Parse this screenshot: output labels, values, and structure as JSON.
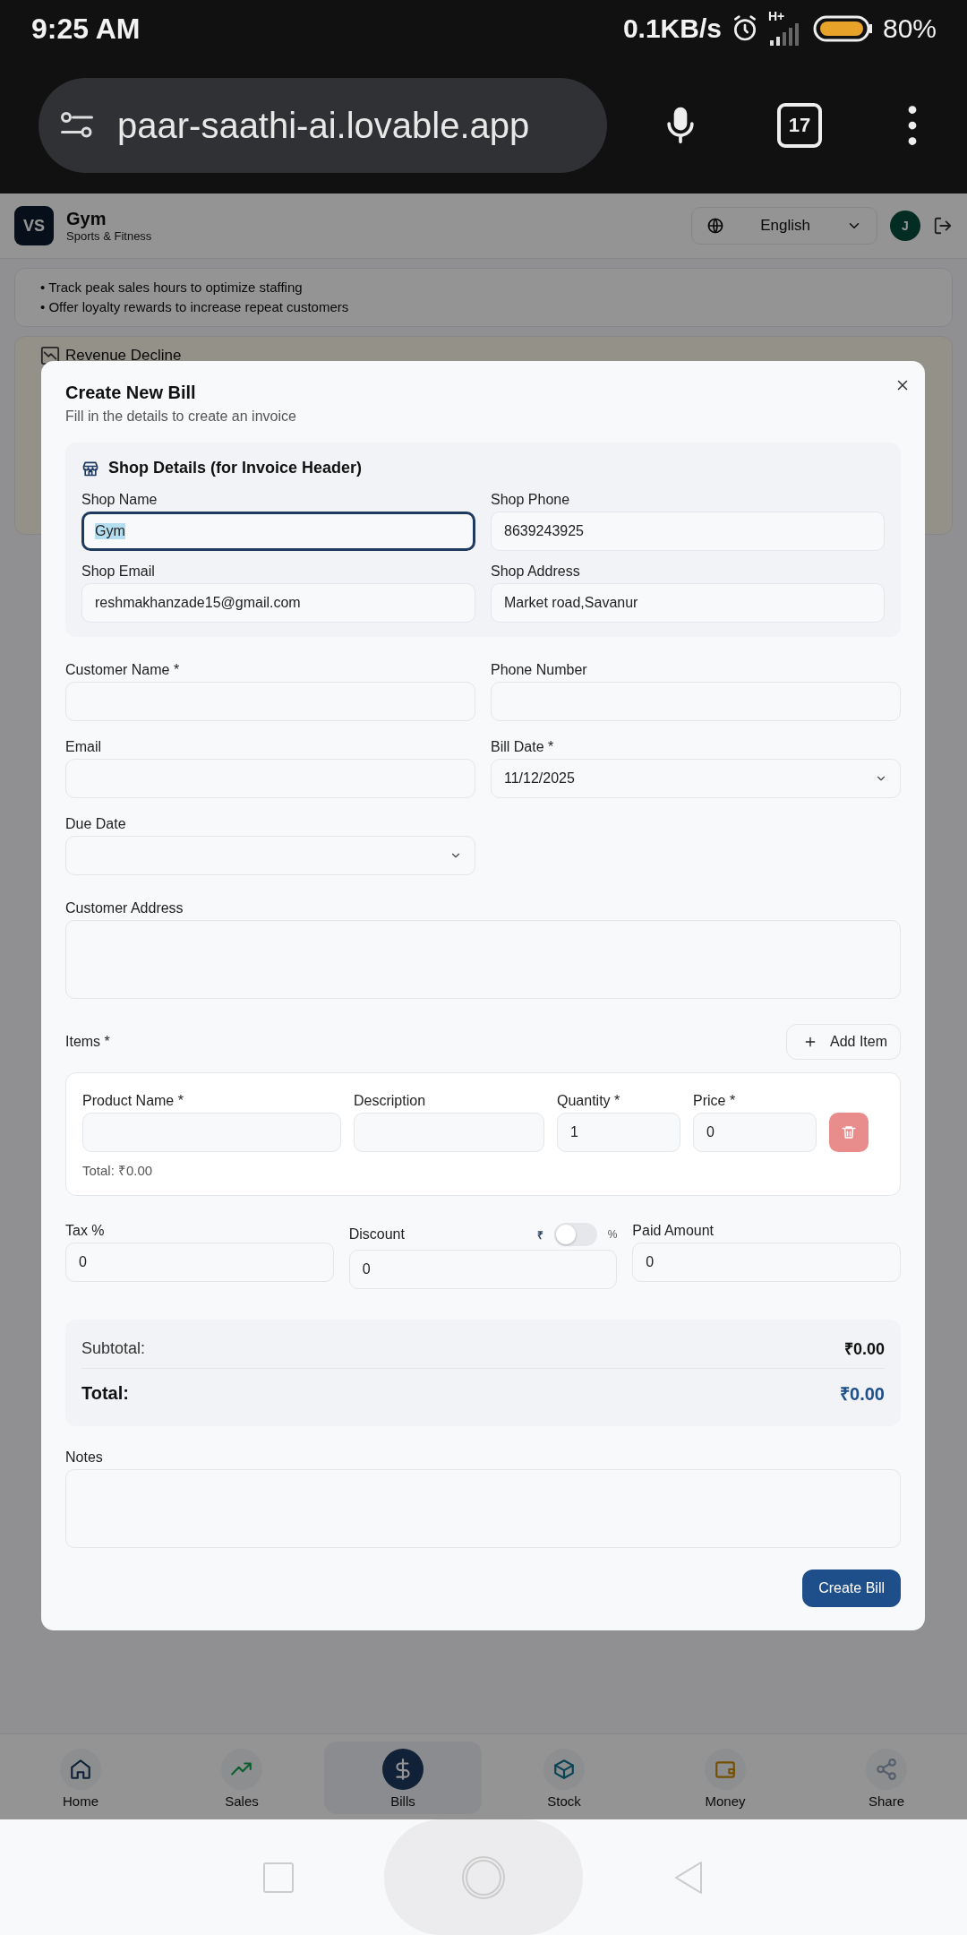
{
  "status_bar": {
    "time": "9:25 AM",
    "net_speed": "0.1KB/s",
    "network": "H+",
    "battery": "80%"
  },
  "browser": {
    "url": "paar-saathi-ai.lovable.app",
    "tab_count": "17"
  },
  "app_header": {
    "logo": "VS",
    "title": "Gym",
    "subtitle": "Sports & Fitness",
    "language": "English",
    "avatar": "J"
  },
  "background_content": {
    "tips": [
      "• Track peak sales hours to optimize staffing",
      "• Offer loyalty rewards to increase repeat customers"
    ],
    "alert_title": "Revenue Decline"
  },
  "bottom_nav": [
    {
      "label": "Home",
      "selected": false
    },
    {
      "label": "Sales",
      "selected": false
    },
    {
      "label": "Bills",
      "selected": true
    },
    {
      "label": "Stock",
      "selected": false
    },
    {
      "label": "Money",
      "selected": false
    },
    {
      "label": "Share",
      "selected": false
    }
  ],
  "dialog": {
    "title": "Create New Bill",
    "subtitle": "Fill in the details to create an invoice",
    "shop_details": {
      "heading": "Shop Details (for Invoice Header)",
      "fields": [
        {
          "label": "Shop Name",
          "value": "Gym",
          "focused": true
        },
        {
          "label": "Shop Phone",
          "value": "8639243925",
          "focused": false
        },
        {
          "label": "Shop Email",
          "value": "reshmakhanzade15@gmail.com",
          "focused": false
        },
        {
          "label": "Shop Address",
          "value": "Market road,Savanur",
          "focused": false
        }
      ]
    },
    "fields": [
      {
        "label": "Customer Name *",
        "kind": "text"
      },
      {
        "label": "Phone Number",
        "kind": "text"
      },
      {
        "label": "Email",
        "kind": "text"
      },
      {
        "label": "Bill Date *",
        "kind": "select",
        "value": "11/12/2025"
      },
      {
        "label": "Due Date",
        "kind": "select"
      },
      {
        "label": "Customer Address",
        "kind": "textarea"
      }
    ],
    "items": {
      "label": "Items *",
      "add_button": "Add Item",
      "rows": [
        {
          "fields": [
            {
              "label": "Product Name *"
            },
            {
              "label": "Description"
            },
            {
              "label": "Quantity *",
              "value": "1"
            },
            {
              "label": "Price *",
              "value": "0"
            }
          ],
          "total": "Total: ₹0.00"
        }
      ]
    },
    "charges": [
      {
        "label": "Tax %",
        "value": "0",
        "kind": "plain"
      },
      {
        "label": "Discount",
        "value": "0",
        "kind": "discount",
        "toggle": {
          "left": "₹",
          "right": "%",
          "on": false
        }
      },
      {
        "label": "Paid Amount",
        "value": "0",
        "kind": "plain"
      }
    ],
    "summary": {
      "subtotal_label": "Subtotal:",
      "subtotal": "₹0.00",
      "total_label": "Total:",
      "total": "₹0.00"
    },
    "notes_label": "Notes",
    "submit": "Create Bill"
  }
}
